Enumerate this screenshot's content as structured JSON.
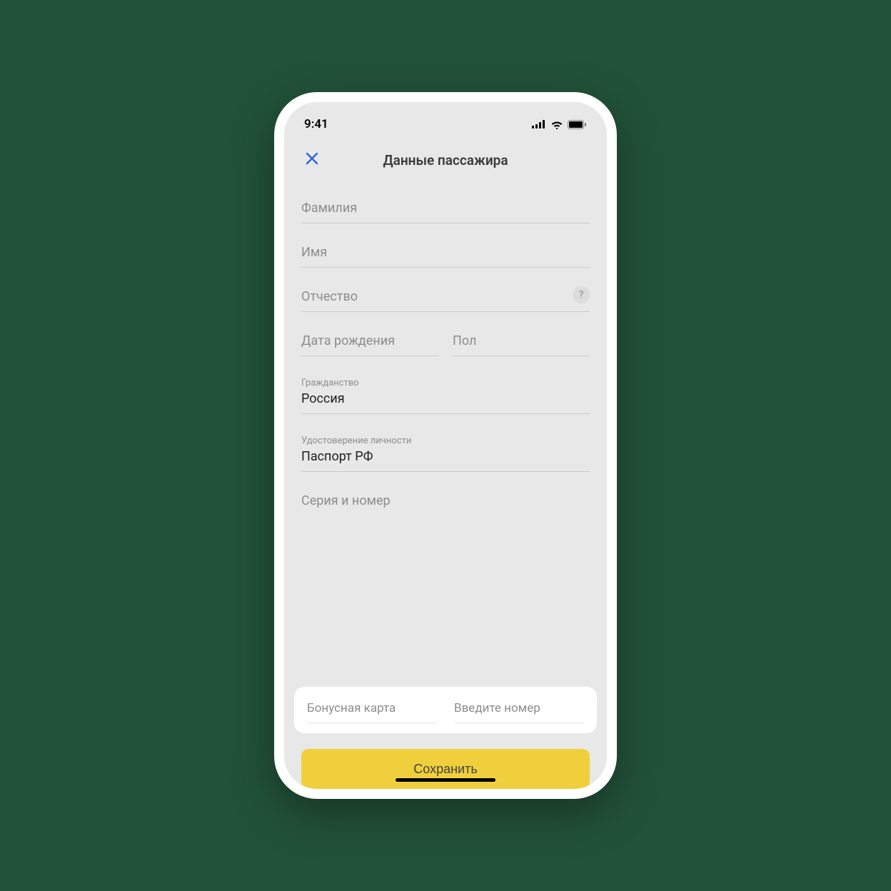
{
  "status": {
    "time": "9:41"
  },
  "header": {
    "title": "Данные пассажира"
  },
  "form": {
    "surname_placeholder": "Фамилия",
    "name_placeholder": "Имя",
    "patronymic_placeholder": "Отчество",
    "birthdate_placeholder": "Дата рождения",
    "gender_placeholder": "Пол",
    "citizenship_label": "Гражданство",
    "citizenship_value": "Россия",
    "id_label": "Удостоверение личности",
    "id_value": "Паспорт РФ",
    "series_number_placeholder": "Серия и номер",
    "help_symbol": "?"
  },
  "bonus": {
    "card_placeholder": "Бонусная карта",
    "number_placeholder": "Введите номер"
  },
  "actions": {
    "save_label": "Сохранить"
  }
}
